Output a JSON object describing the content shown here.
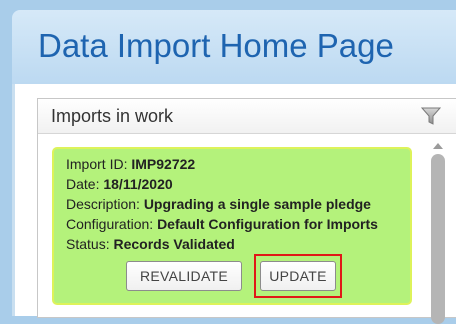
{
  "header": {
    "title": "Data Import Home Page"
  },
  "panel": {
    "title": "Imports in work",
    "filter_icon": "filter-icon"
  },
  "import": {
    "id_label": "Import ID:",
    "id_value": "IMP92722",
    "date_label": "Date:",
    "date_value": "18/11/2020",
    "description_label": "Description:",
    "description_value": "Upgrading a single sample pledge",
    "configuration_label": "Configuration:",
    "configuration_value": "Default Configuration for Imports",
    "status_label": "Status:",
    "status_value": "Records Validated"
  },
  "buttons": {
    "revalidate": "REVALIDATE",
    "update": "UPDATE"
  },
  "colors": {
    "card_background": "#b4f27b",
    "title": "#1e64b0",
    "highlight": "#e01818"
  }
}
